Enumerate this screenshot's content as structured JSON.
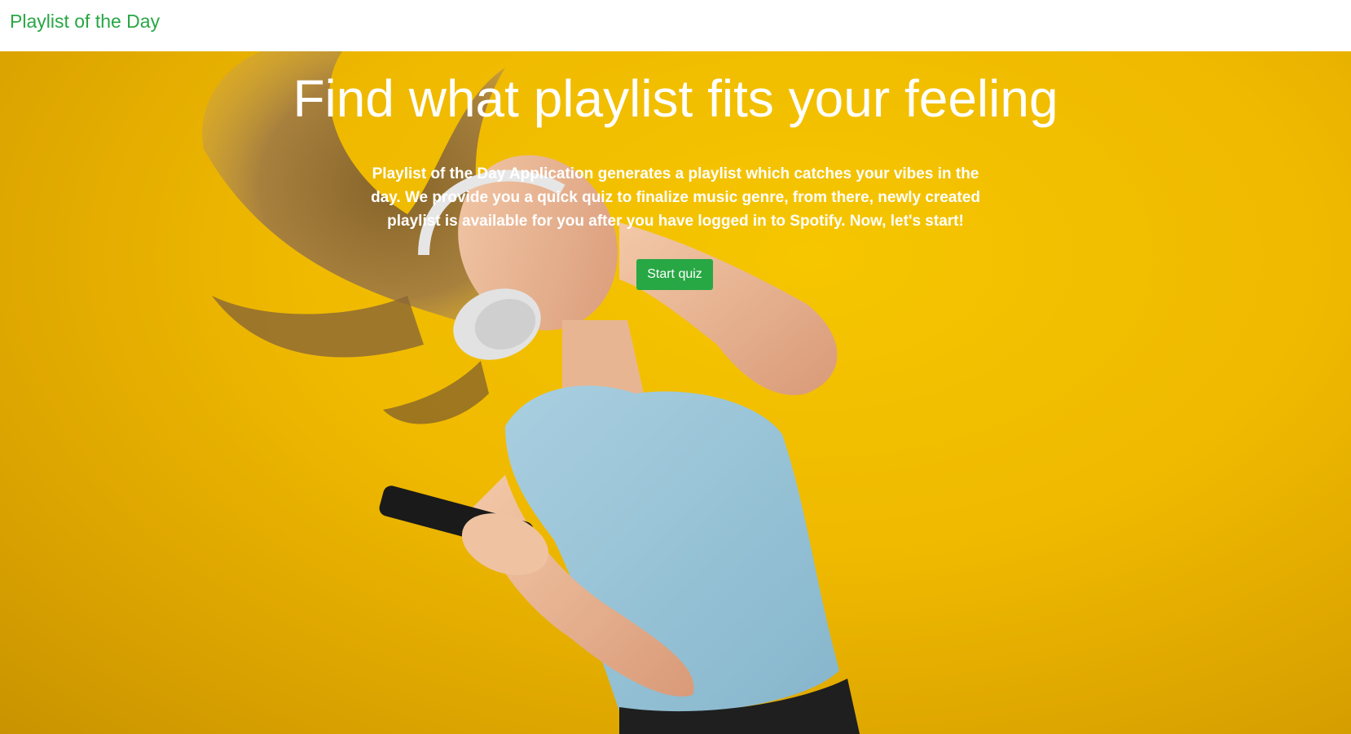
{
  "navbar": {
    "brand": "Playlist of the Day"
  },
  "hero": {
    "title": "Find what playlist fits your feeling",
    "description": "Playlist of the Day Application generates a playlist which catches your vibes in the day. We provide you a quick quiz to finalize music genre, from there, newly created playlist is available for you after you have logged in to Spotify. Now, let's start!",
    "cta_label": "Start quiz",
    "background_image": "woman-with-headphones-dancing-photo"
  },
  "colors": {
    "brand": "#28a745",
    "hero_background": "#f2bd00",
    "text_on_hero": "#ffffff"
  }
}
